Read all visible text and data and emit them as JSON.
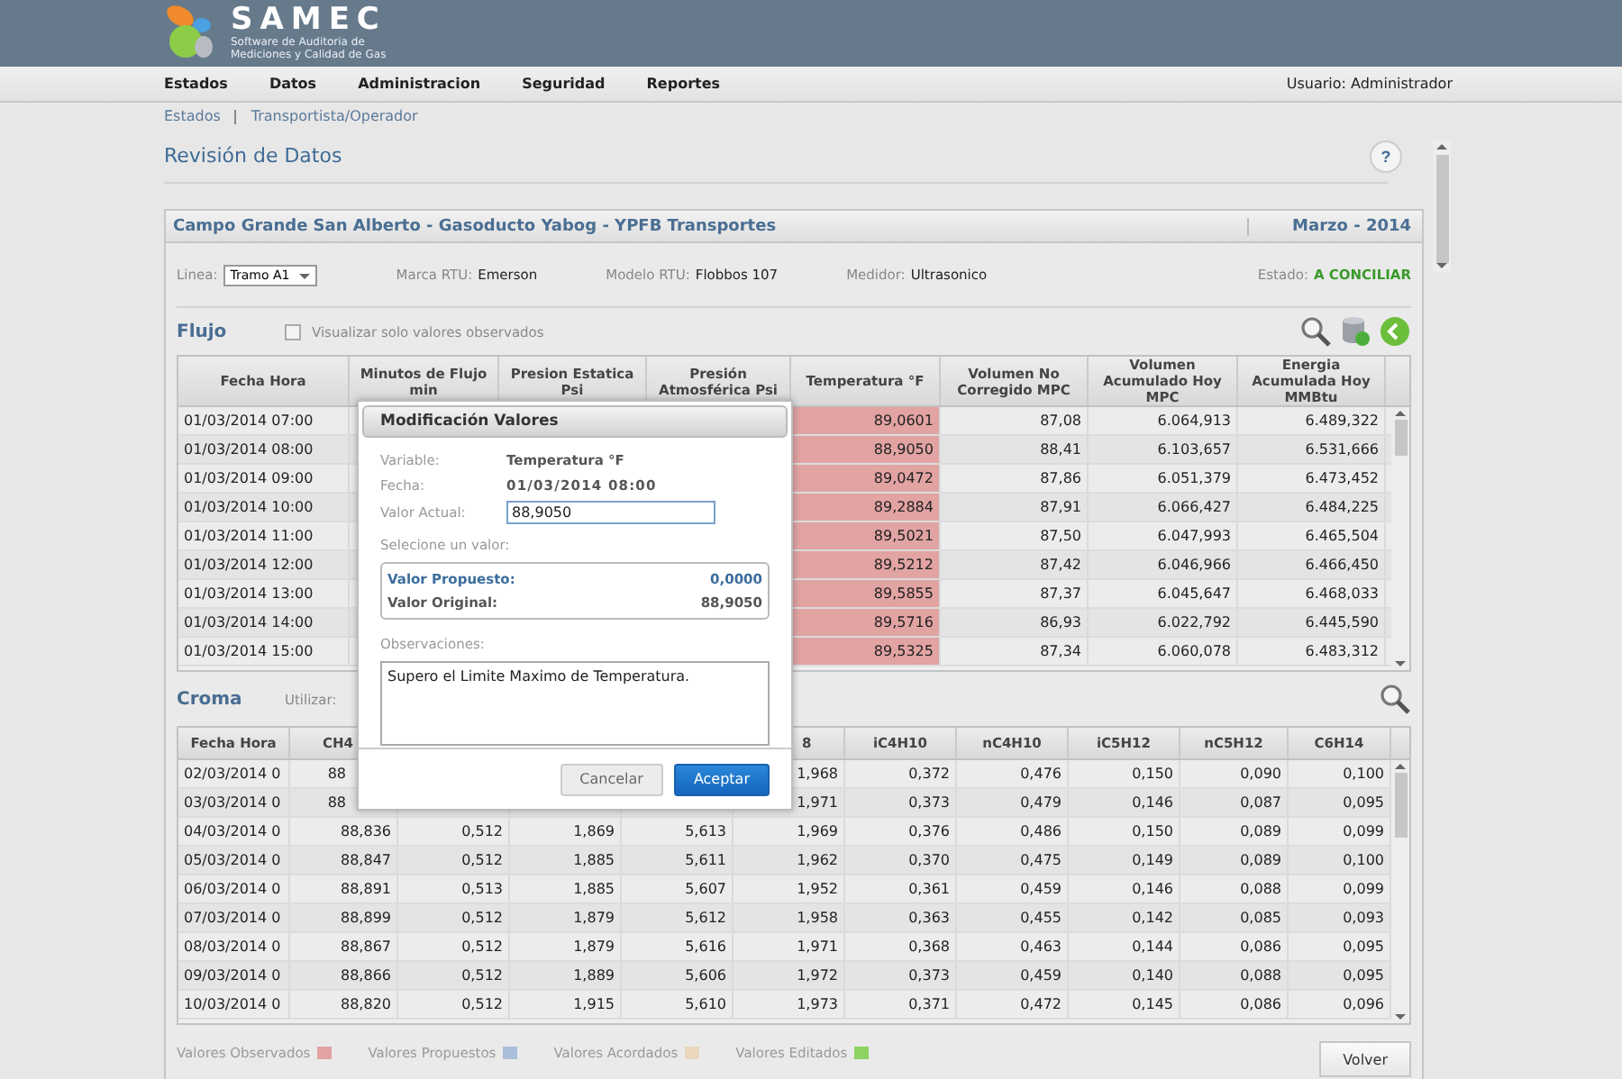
{
  "app": {
    "name": "SAMEC",
    "subtitle": "Software de Auditoria de Mediciones y Calidad de Gas"
  },
  "menu": [
    {
      "label": "Estados"
    },
    {
      "label": "Datos"
    },
    {
      "label": "Administracion"
    },
    {
      "label": "Seguridad"
    },
    {
      "label": "Reportes"
    }
  ],
  "user": "Usuario: Administrador",
  "breadcrumb": [
    "Estados",
    "Transportista/Operador"
  ],
  "page_title": "Revisión de Datos",
  "help": "?",
  "panel": {
    "title": "Campo Grande San Alberto - Gasoducto Yabog - YPFB Transportes",
    "period": "Marzo - 2014",
    "info": {
      "linea_label": "Linea:",
      "linea_value": "Tramo A1",
      "marca_label": "Marca RTU:",
      "marca": "Emerson",
      "modelo_label": "Modelo RTU:",
      "modelo": "Flobbos 107",
      "medidor_label": "Medidor:",
      "medidor": "Ultrasonico",
      "estado_label": "Estado:",
      "estado": "A CONCILIAR"
    }
  },
  "flujo": {
    "title": "Flujo",
    "filter": {
      "label": "Visualizar solo valores observados",
      "checked": false
    },
    "columns": [
      "Fecha Hora",
      "Minutos de Flujo min",
      "Presion Estatica Psi",
      "Presión Atmosférica Psi",
      "Temperatura °F",
      "Volumen No Corregido MPC",
      "Volumen Acumulado Hoy MPC",
      "Energia Acumulada Hoy MMBtu"
    ],
    "rows": [
      {
        "fecha": "01/03/2014 07:00",
        "temperatura": "89,0601",
        "volumen_no_corregido": "87,08",
        "volumen_acumulado": "6.064,913",
        "energia": "6.489,322",
        "observed": true
      },
      {
        "fecha": "01/03/2014 08:00",
        "temperatura": "88,9050",
        "volumen_no_corregido": "88,41",
        "volumen_acumulado": "6.103,657",
        "energia": "6.531,666",
        "observed": true
      },
      {
        "fecha": "01/03/2014 09:00",
        "temperatura": "89,0472",
        "volumen_no_corregido": "87,86",
        "volumen_acumulado": "6.051,379",
        "energia": "6.473,452",
        "observed": true
      },
      {
        "fecha": "01/03/2014 10:00",
        "temperatura": "89,2884",
        "volumen_no_corregido": "87,91",
        "volumen_acumulado": "6.066,427",
        "energia": "6.484,225",
        "observed": true
      },
      {
        "fecha": "01/03/2014 11:00",
        "temperatura": "89,5021",
        "volumen_no_corregido": "87,50",
        "volumen_acumulado": "6.047,993",
        "energia": "6.465,504",
        "observed": true
      },
      {
        "fecha": "01/03/2014 12:00",
        "temperatura": "89,5212",
        "volumen_no_corregido": "87,42",
        "volumen_acumulado": "6.046,966",
        "energia": "6.466,450",
        "observed": true
      },
      {
        "fecha": "01/03/2014 13:00",
        "temperatura": "89,5855",
        "volumen_no_corregido": "87,37",
        "volumen_acumulado": "6.045,647",
        "energia": "6.468,033",
        "observed": true
      },
      {
        "fecha": "01/03/2014 14:00",
        "temperatura": "89,5716",
        "volumen_no_corregido": "86,93",
        "volumen_acumulado": "6.022,792",
        "energia": "6.445,590",
        "observed": true
      },
      {
        "fecha": "01/03/2014 15:00",
        "temperatura": "89,5325",
        "volumen_no_corregido": "87,34",
        "volumen_acumulado": "6.060,078",
        "energia": "6.483,312",
        "observed": true
      }
    ]
  },
  "croma": {
    "title": "Croma",
    "utilizar_label": "Utilizar:",
    "columns": [
      {
        "label": "Fecha Hora"
      },
      {
        "label": "CH4"
      },
      {},
      {},
      {},
      {
        "label": "8"
      },
      {
        "label": "iC4H10"
      },
      {
        "label": "nC4H10"
      },
      {
        "label": "iC5H12"
      },
      {
        "label": "nC5H12"
      },
      {
        "label": "C6H14"
      }
    ],
    "rows": [
      [
        "02/03/2014 0",
        "88",
        null,
        null,
        null,
        "1,968",
        "0,372",
        "0,476",
        "0,150",
        "0,090",
        "0,100"
      ],
      [
        "03/03/2014 0",
        "88",
        null,
        null,
        null,
        "1,971",
        "0,373",
        "0,479",
        "0,146",
        "0,087",
        "0,095"
      ],
      [
        "04/03/2014 0",
        "88,836",
        "0,512",
        "1,869",
        "5,613",
        "1,969",
        "0,376",
        "0,486",
        "0,150",
        "0,089",
        "0,099"
      ],
      [
        "05/03/2014 0",
        "88,847",
        "0,512",
        "1,885",
        "5,611",
        "1,962",
        "0,370",
        "0,475",
        "0,149",
        "0,089",
        "0,100"
      ],
      [
        "06/03/2014 0",
        "88,891",
        "0,513",
        "1,885",
        "5,607",
        "1,952",
        "0,361",
        "0,459",
        "0,146",
        "0,088",
        "0,099"
      ],
      [
        "07/03/2014 0",
        "88,899",
        "0,512",
        "1,879",
        "5,612",
        "1,958",
        "0,363",
        "0,455",
        "0,142",
        "0,085",
        "0,093"
      ],
      [
        "08/03/2014 0",
        "88,867",
        "0,512",
        "1,879",
        "5,616",
        "1,971",
        "0,368",
        "0,463",
        "0,144",
        "0,086",
        "0,095"
      ],
      [
        "09/03/2014 0",
        "88,866",
        "0,512",
        "1,889",
        "5,606",
        "1,972",
        "0,373",
        "0,459",
        "0,140",
        "0,088",
        "0,095"
      ],
      [
        "10/03/2014 0",
        "88,820",
        "0,512",
        "1,915",
        "5,610",
        "1,973",
        "0,371",
        "0,472",
        "0,145",
        "0,086",
        "0,096"
      ]
    ]
  },
  "legend": [
    {
      "label": "Valores Observados",
      "color": "#e2a3a3"
    },
    {
      "label": "Valores Propuestos",
      "color": "#a9bedb"
    },
    {
      "label": "Valores Acordados",
      "color": "#ead6bc"
    },
    {
      "label": "Valores Editados",
      "color": "#8ed264"
    }
  ],
  "volver": "Volver",
  "dialog": {
    "title": "Modificación Valores",
    "variable_label": "Variable:",
    "variable": "Temperatura °F",
    "fecha_label": "Fecha:",
    "fecha": "01/03/2014 08:00",
    "actual_label": "Valor Actual:",
    "actual": "88,9050",
    "select_label": "Selecione un valor:",
    "options": [
      {
        "label": "Valor Propuesto:",
        "value": "0,0000",
        "selected": true
      },
      {
        "label": "Valor Original:",
        "value": "88,9050",
        "selected": false
      }
    ],
    "obs_label": "Observaciones:",
    "obs": "Supero el Limite Maximo de Temperatura.",
    "cancel": "Cancelar",
    "accept": "Aceptar"
  }
}
